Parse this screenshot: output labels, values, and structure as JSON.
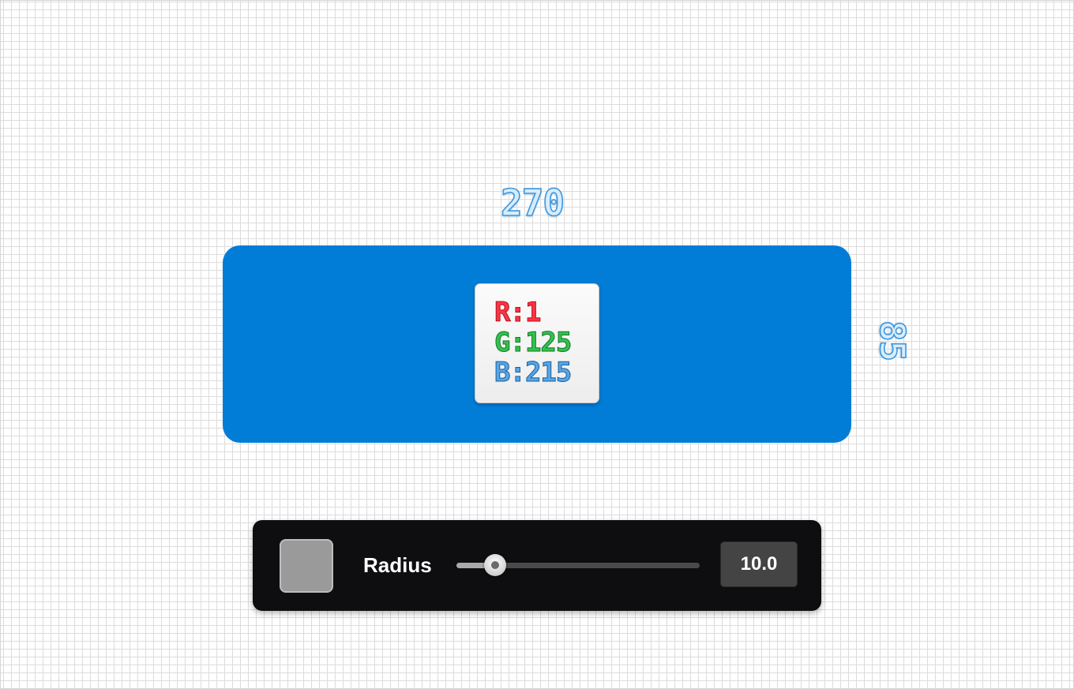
{
  "colors": {
    "shape_fill": "#017dd7",
    "swatch_fill": "#9a9a9a"
  },
  "dimensions": {
    "width": "270",
    "height": "85"
  },
  "rgb_card": {
    "r": "R:1",
    "g": "G:125",
    "b": "B:215"
  },
  "toolbar": {
    "radius_label": "Radius",
    "radius_value": "10.0",
    "slider_fraction": 0.16
  }
}
